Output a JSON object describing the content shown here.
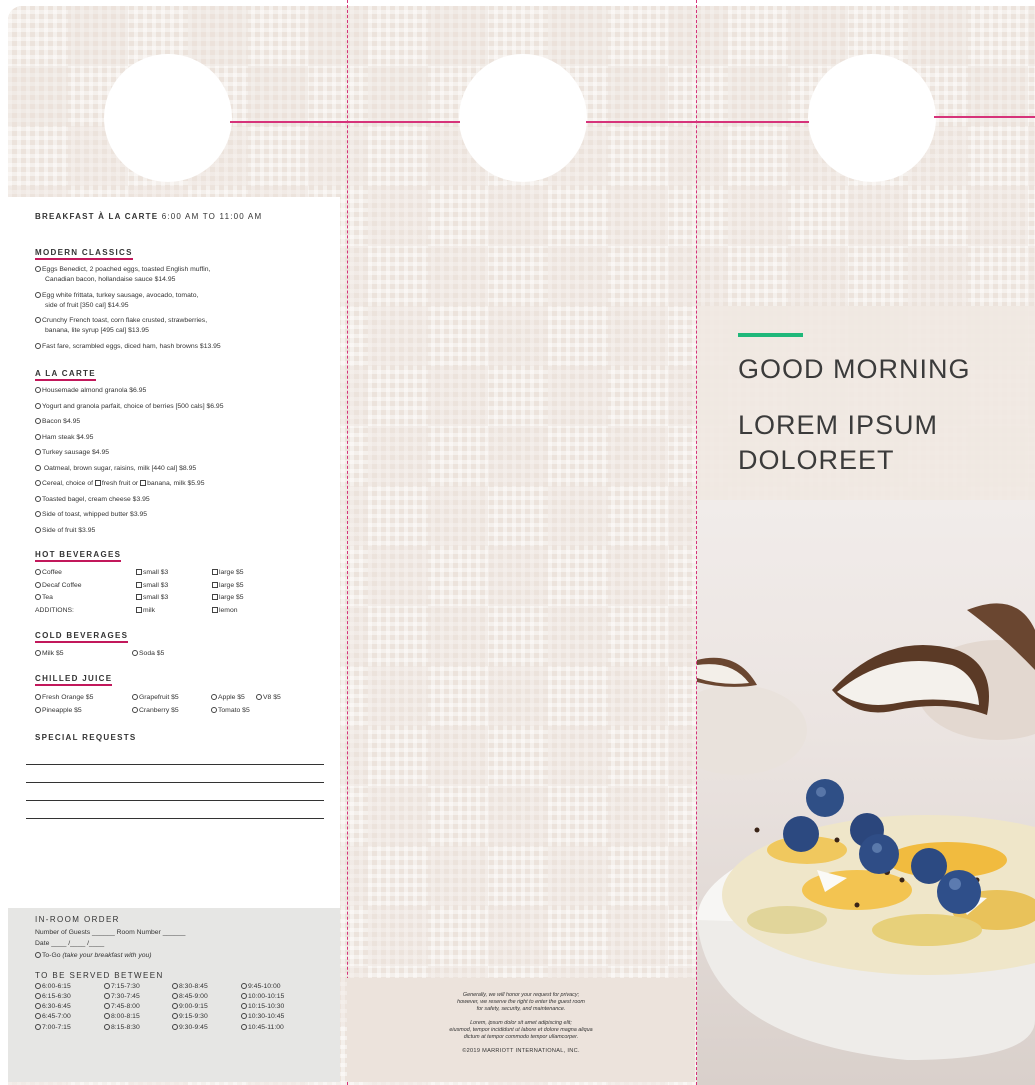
{
  "header": {
    "title_bold": "BREAKFAST À LA CARTE",
    "title_hours": "6:00 AM TO 11:00 AM"
  },
  "modern_classics": {
    "heading": "MODERN CLASSICS",
    "items": [
      {
        "line1": "Eggs Benedict, 2 poached eggs, toasted English muffin,",
        "line2": "Canadian bacon, hollandaise sauce  $14.95"
      },
      {
        "line1": "Egg white frittata, turkey sausage, avocado, tomato,",
        "line2": "side of fruit [350 cal]  $14.95"
      },
      {
        "line1": "Crunchy French toast, corn flake crusted, strawberries,",
        "line2": "banana, lite syrup [495 cal]  $13.95"
      },
      {
        "line1": "Fast fare, scrambled eggs, diced ham, hash browns  $13.95",
        "line2": ""
      }
    ]
  },
  "a_la_carte": {
    "heading": "A LA CARTE",
    "items": [
      "Housemade almond granola  $6.95",
      "Yogurt and granola parfait, choice of berries [500 cals]  $6.95",
      "Bacon  $4.95",
      "Ham steak  $4.95",
      "Turkey sausage  $4.95",
      " Oatmeal, brown sugar, raisins, milk [440 cal]  $8.95"
    ],
    "cereal": {
      "a": "Cereal, choice of ",
      "b": "fresh fruit or ",
      "c": "banana, milk  $5.95"
    },
    "items2": [
      "Toasted bagel, cream cheese  $3.95",
      "Side of toast, whipped butter  $3.95",
      "Side of fruit  $3.95"
    ]
  },
  "hot_beverages": {
    "heading": "HOT BEVERAGES",
    "rows": [
      {
        "name": "Coffee",
        "small": "small $3",
        "large": "large $5"
      },
      {
        "name": "Decaf Coffee",
        "small": "small $3",
        "large": "large $5"
      },
      {
        "name": "Tea",
        "small": "small $3",
        "large": "large $5"
      }
    ],
    "additions_label": "ADDITIONS:",
    "milk": "milk",
    "lemon": "lemon"
  },
  "cold_beverages": {
    "heading": "COLD BEVERAGES",
    "items": [
      "Milk  $5",
      "Soda  $5"
    ]
  },
  "chilled_juice": {
    "heading": "CHILLED JUICE",
    "items": [
      "Fresh Orange  $5",
      "Grapefruit  $5",
      "Apple  $5",
      "V8  $5",
      "Pineapple  $5",
      "Cranberry  $5",
      "Tomato  $5"
    ]
  },
  "special_requests": {
    "heading": "SPECIAL REQUESTS"
  },
  "in_room_order": {
    "heading": "IN-ROOM ORDER",
    "guests_line": "Number of Guests ______  Room Number ______",
    "date_line": "Date  ____ /____ /____",
    "to_go": "To-Go ",
    "to_go_note": "(take your breakfast with you)",
    "served_heading": "TO BE SERVED BETWEEN",
    "slots": [
      "6:00-6:15",
      "7:15-7:30",
      "8:30-8:45",
      "9:45-10:00",
      "6:15-6:30",
      "7:30-7:45",
      "8:45-9:00",
      "10:00-10:15",
      "6:30-6:45",
      "7:45-8:00",
      "9:00-9:15",
      "10:15-10:30",
      "6:45-7:00",
      "8:00-8:15",
      "9:15-9:30",
      "10:30-10:45",
      "7:00-7:15",
      "8:15-8:30",
      "9:30-9:45",
      "10:45-11:00"
    ]
  },
  "middle_footer": {
    "privacy_1": "Generally, we will honor your request for privacy;",
    "privacy_2": "however, we reserve the right to enter the guest room",
    "privacy_3": "for safety, security, and maintenance.",
    "lorem_1": "Lorem, ipsum dolor sit amet adipiscing elit;",
    "lorem_2": "eiusmod, tempor incididunt ut labore et dolore magna aliqua",
    "lorem_3": "dictum at tempor commodo tempor ullamcorper.",
    "copyright": "©2019  MARRIOTT INTERNATIONAL, INC."
  },
  "cover": {
    "title_line1": "GOOD MORNING",
    "title_line2": "LOREM IPSUM DOLOREET",
    "accent_color": "#1fb87a"
  },
  "colors": {
    "fold_line": "#d6337a",
    "section_underline": "#c2185b",
    "background": "#ece3dc"
  }
}
